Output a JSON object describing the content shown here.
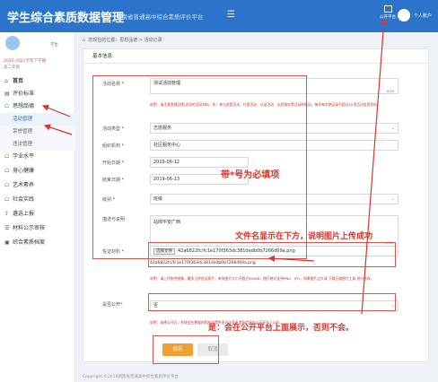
{
  "header": {
    "title": "学生综合素质数据管理",
    "subtitle": "湖南省普通高中综合素质评价平台",
    "menu_icon": "menu-icon",
    "public_platform_label": "公开平台",
    "user_label": "个人账户",
    "brand_color": "#2c74c9"
  },
  "sidebar": {
    "role": "学生",
    "semester": "2020-2021学年下学期",
    "grade": "高二年级",
    "items": [
      {
        "label": "首页",
        "icon": "home-icon"
      },
      {
        "label": "评价标准",
        "icon": "book-icon"
      },
      {
        "label": "思想品德",
        "icon": "graduation-icon"
      },
      {
        "label": "学业水平",
        "icon": "graduation-icon"
      },
      {
        "label": "身心健康",
        "icon": "graduation-icon"
      },
      {
        "label": "艺术素养",
        "icon": "graduation-icon"
      },
      {
        "label": "社会实践",
        "icon": "graduation-icon"
      },
      {
        "label": "遴选上报",
        "icon": "upload-icon"
      },
      {
        "label": "材料公示审核",
        "icon": "list-icon"
      },
      {
        "label": "综合素质档案",
        "icon": "archive-icon"
      }
    ],
    "subitems": [
      "活动管理",
      "荣誉管理",
      "违法管理"
    ]
  },
  "breadcrumb": {
    "text": "您现在的位置：思想品德 > 活动记录"
  },
  "form": {
    "section_title": "基本信息",
    "fields": {
      "activity_name": {
        "label": "活动名称 *",
        "value": "测试活动管理",
        "counter": "6/50"
      },
      "name_hint": "说明：请注意思想品德/活动的活动材料，如：参与党团活动、社团活动、公益活动、志愿服务等活动的情况。每年每学期记录不超过10项活动信息资料。",
      "activity_type": {
        "label": "活动类型 *",
        "value": "志愿服务"
      },
      "organizer": {
        "label": "组织机构 *",
        "value": "社区服务中心"
      },
      "start_date": {
        "label": "开始日期 *",
        "value": "2019-06-12"
      },
      "end_date": {
        "label": "结束日期 *",
        "value": "2019-06-13"
      },
      "level": {
        "label": "级别 *",
        "value": "班级"
      },
      "description": {
        "label": "描述与说明",
        "value": "站岗平安广西",
        "counter": "6/300"
      },
      "evidence": {
        "label": "佐证材料 *",
        "button": "选择文件",
        "file": "42a6822fc/fc1e170f363dc381dedb0b7266d69a.png",
        "file_display": "42a6822fc/fc1e170f363dc381dedb0b7266d69a.png"
      },
      "evidence_hint": "说明：请上传附件图像，最多上传佐证照片，单张图片大小不超过500KB，图片格式支持PNG、JPG，如果图片过大请 下载压缩图片工具 进行修改。",
      "is_public": {
        "label": "是否公开*",
        "value": "否"
      },
      "public_hint": "说明：选择公开后，系统会在数据的相应位置供多方全面参考的信息在公开平台上公开。"
    },
    "save_button": "保存",
    "cancel_button": "取消"
  },
  "annotations": {
    "required_note": "带*号为必填项",
    "upload_note": "文件名显示在下方，说明图片上传成功",
    "public_note": "是：会在公开平台上面展示，否则不会。",
    "annotation_color": "#d9342b"
  },
  "footer": {
    "text": "Copyright ©2019湖南省普通高中综合素质评价平台"
  }
}
